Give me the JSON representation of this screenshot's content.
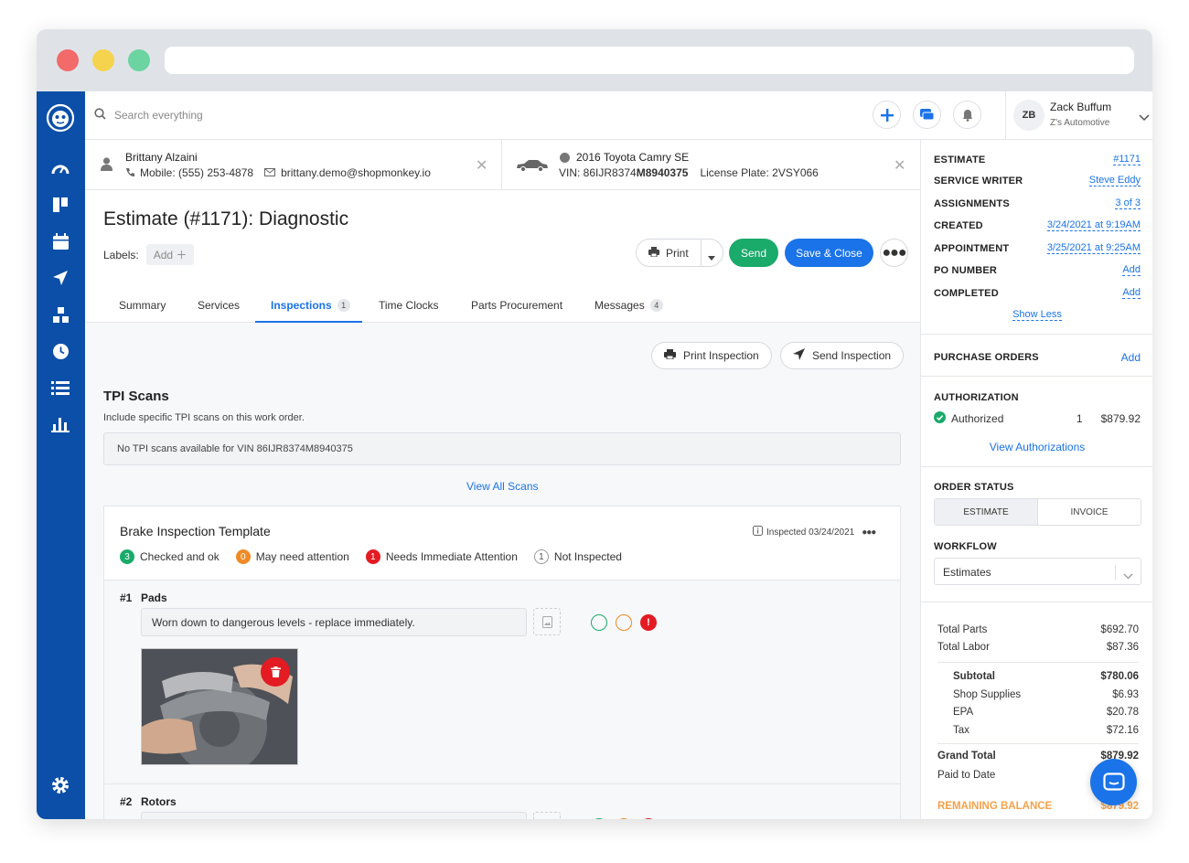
{
  "colors": {
    "accent": "#1a73e8",
    "sidebar": "#0b4fa8",
    "green": "#1aaa6a",
    "orange": "#f08a24",
    "red": "#e31b23",
    "remaining": "#f5a14a"
  },
  "topbar": {
    "search_placeholder": "Search everything",
    "user_initials": "ZB",
    "user_name": "Zack Buffum",
    "user_shop": "Z's Automotive"
  },
  "customer": {
    "name": "Brittany Alzaini",
    "mobile": "Mobile: (555) 253-4878",
    "email": "brittany.demo@shopmonkey.io"
  },
  "vehicle": {
    "name": "2016 Toyota Camry SE",
    "vin_prefix": "VIN: 86IJR8374",
    "vin_suffix": "M8940375",
    "plate": "License Plate: 2VSY066"
  },
  "estimate": {
    "title": "Estimate (#1171):",
    "subtitle": "Diagnostic",
    "labels_label": "Labels:",
    "add_label": "Add"
  },
  "actions": {
    "print": "Print",
    "send": "Send",
    "save_close": "Save & Close"
  },
  "tabs": [
    {
      "label": "Summary"
    },
    {
      "label": "Services"
    },
    {
      "label": "Inspections",
      "count": "1"
    },
    {
      "label": "Time Clocks"
    },
    {
      "label": "Parts Procurement"
    },
    {
      "label": "Messages",
      "count": "4"
    }
  ],
  "inspection_actions": {
    "print": "Print Inspection",
    "send": "Send Inspection"
  },
  "tpi": {
    "title": "TPI Scans",
    "subtitle": "Include specific TPI scans on this work order.",
    "empty": "No TPI scans available for VIN 86IJR8374M8940375",
    "view_all": "View All Scans"
  },
  "template": {
    "title": "Brake Inspection Template",
    "inspected": "Inspected 03/24/2021",
    "legend": [
      {
        "count": "3",
        "label": "Checked and ok"
      },
      {
        "count": "0",
        "label": "May need attention"
      },
      {
        "count": "1",
        "label": "Needs Immediate Attention"
      },
      {
        "count": "1",
        "label": "Not Inspected"
      }
    ],
    "items": [
      {
        "num": "#1",
        "name": "Pads",
        "note": "Worn down to dangerous levels - replace immediately."
      },
      {
        "num": "#2",
        "name": "Rotors",
        "note": ""
      }
    ]
  },
  "details": {
    "estimate": {
      "label": "ESTIMATE",
      "value": "#1171"
    },
    "service_writer": {
      "label": "SERVICE WRITER",
      "value": "Steve Eddy"
    },
    "assignments": {
      "label": "ASSIGNMENTS",
      "value": "3 of 3"
    },
    "created": {
      "label": "CREATED",
      "value": "3/24/2021 at 9:19AM"
    },
    "appointment": {
      "label": "APPOINTMENT",
      "value": "3/25/2021 at 9:25AM"
    },
    "po_number": {
      "label": "PO NUMBER",
      "value": "Add"
    },
    "completed": {
      "label": "COMPLETED",
      "value": "Add"
    },
    "show_less": "Show Less"
  },
  "purchase_orders": {
    "label": "PURCHASE ORDERS",
    "add": "Add"
  },
  "authorization": {
    "label": "AUTHORIZATION",
    "status": "Authorized",
    "count": "1",
    "amount": "$879.92",
    "view": "View Authorizations"
  },
  "order_status": {
    "label": "ORDER STATUS",
    "options": [
      "ESTIMATE",
      "INVOICE"
    ],
    "selected": "ESTIMATE"
  },
  "workflow": {
    "label": "WORKFLOW",
    "value": "Estimates"
  },
  "totals": {
    "total_parts": {
      "label": "Total Parts",
      "value": "$692.70"
    },
    "total_labor": {
      "label": "Total Labor",
      "value": "$87.36"
    },
    "subtotal": {
      "label": "Subtotal",
      "value": "$780.06"
    },
    "shop_supplies": {
      "label": "Shop Supplies",
      "value": "$6.93"
    },
    "epa": {
      "label": "EPA",
      "value": "$20.78"
    },
    "tax": {
      "label": "Tax",
      "value": "$72.16"
    },
    "grand_total": {
      "label": "Grand Total",
      "value": "$879.92"
    },
    "paid_to_date": {
      "label": "Paid to Date",
      "value": ""
    },
    "remaining": {
      "label": "REMAINING BALANCE",
      "value": "$879.92"
    }
  }
}
